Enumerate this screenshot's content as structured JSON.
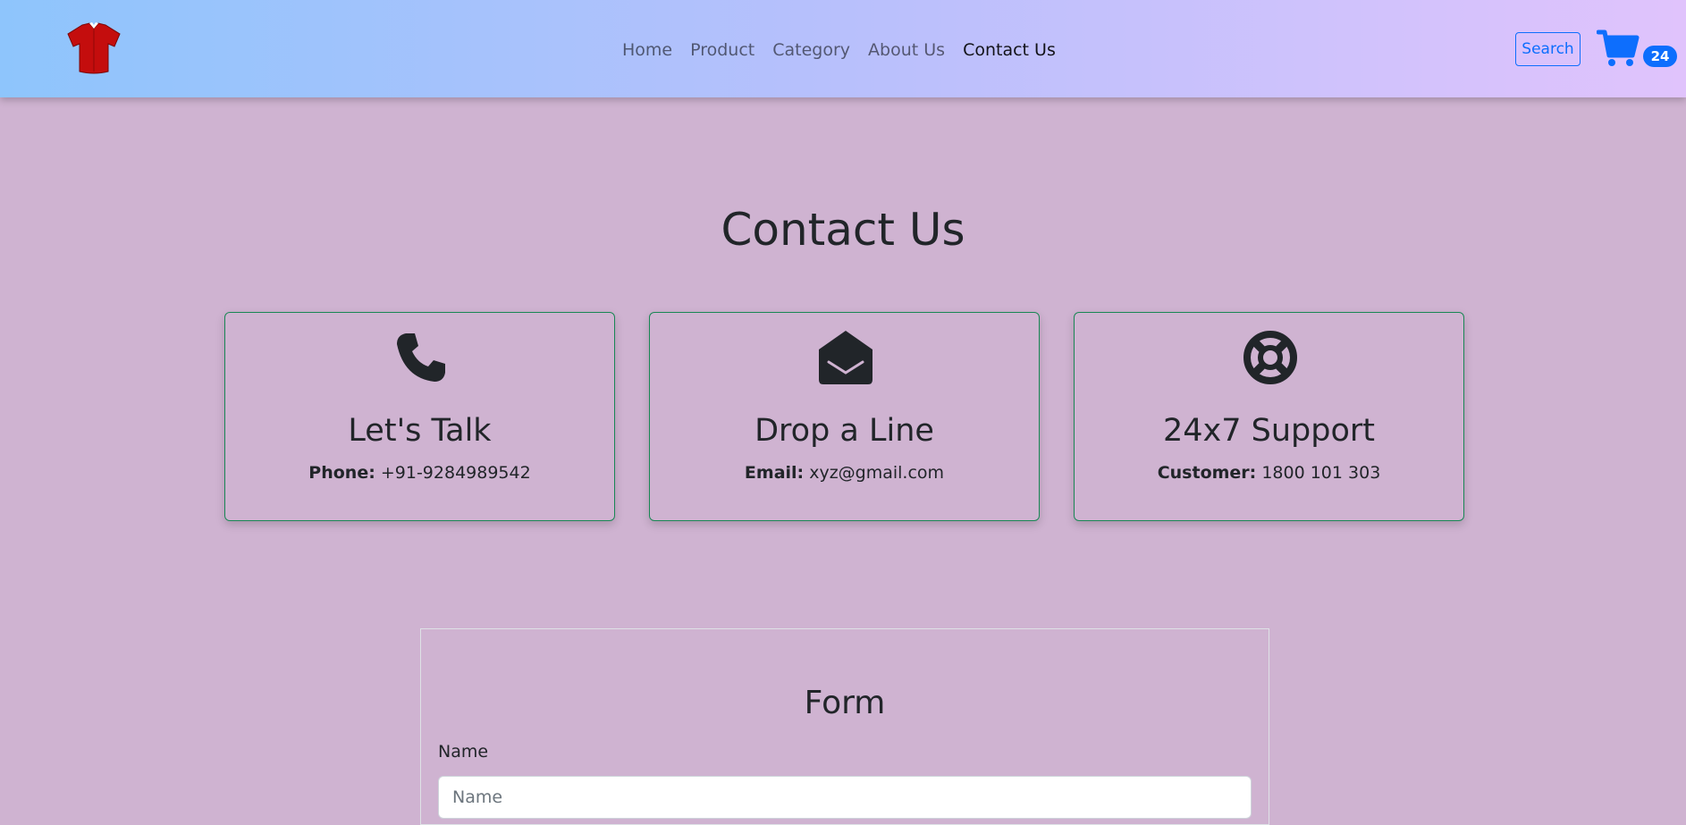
{
  "header": {
    "logo_icon": "red-shirt-icon",
    "nav": [
      {
        "label": "Home"
      },
      {
        "label": "Product"
      },
      {
        "label": "Category"
      },
      {
        "label": "About Us"
      },
      {
        "label": "Contact Us",
        "active": true
      }
    ],
    "search_label": "Search",
    "cart_icon": "shopping-cart-icon",
    "cart_count": "24"
  },
  "page": {
    "title": "Contact Us"
  },
  "cards": [
    {
      "icon": "phone-icon",
      "heading": "Let's Talk",
      "label": "Phone:",
      "value": "+91-9284989542"
    },
    {
      "icon": "envelope-open-icon",
      "heading": "Drop a Line",
      "label": "Email:",
      "value": "xyz@gmail.com"
    },
    {
      "icon": "life-ring-icon",
      "heading": "24x7 Support",
      "label": "Customer:",
      "value": "1800 101 303"
    }
  ],
  "form": {
    "title": "Form",
    "name_label": "Name",
    "name_placeholder": "Name",
    "name_value": ""
  },
  "colors": {
    "background": "#cfb3d1",
    "accent": "#0d6efd",
    "card_border": "#198754"
  }
}
